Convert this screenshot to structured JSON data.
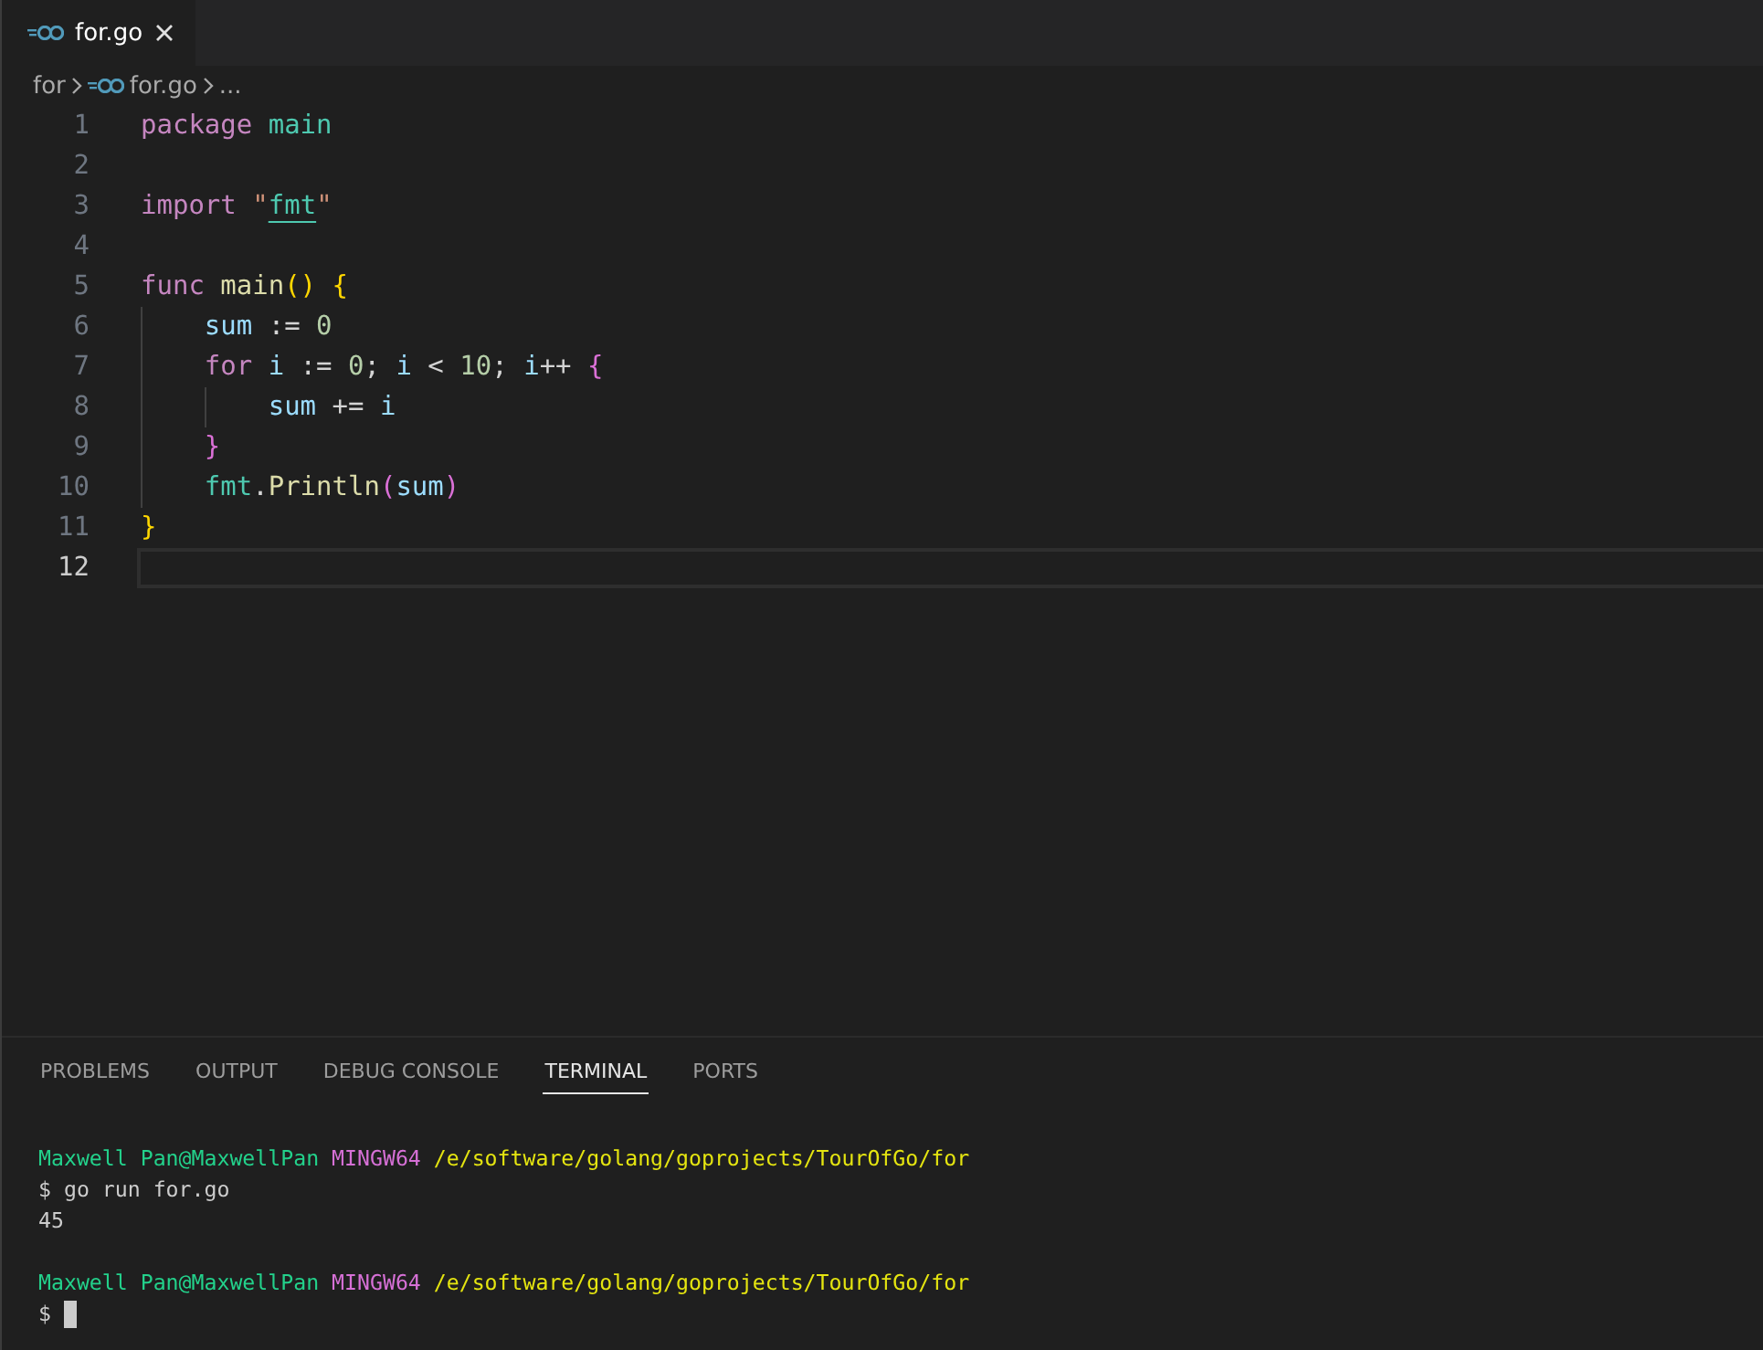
{
  "editor_tabs": [
    {
      "label": "for.go",
      "selected": true
    }
  ],
  "breadcrumb": [
    {
      "kind": "folder",
      "label": "for"
    },
    {
      "kind": "file",
      "label": "for.go"
    },
    {
      "kind": "more",
      "label": "..."
    }
  ],
  "code_lines": [
    {
      "number": "1",
      "current": false,
      "tokens": [
        {
          "kind": "keyword",
          "text": "package"
        },
        {
          "kind": "type",
          "text": " main"
        }
      ]
    },
    {
      "number": "2",
      "current": false
    },
    {
      "number": "3",
      "current": false,
      "tokens": [
        {
          "kind": "keyword",
          "text": "import"
        },
        {
          "kind": "string",
          "text": " \""
        },
        {
          "kind": "link",
          "text": "fmt"
        },
        {
          "kind": "string",
          "text": "\""
        }
      ]
    },
    {
      "number": "4",
      "current": false
    },
    {
      "number": "5",
      "current": false,
      "tokens": [
        {
          "kind": "keyword",
          "text": "func"
        },
        {
          "kind": "function",
          "text": " main"
        },
        {
          "kind": "bracket1",
          "text": "()"
        },
        {
          "kind": "bracket1",
          "text": " {"
        }
      ]
    },
    {
      "number": "6",
      "current": false,
      "tokens": [
        {
          "kind": "variable",
          "text": "    sum"
        },
        {
          "kind": "plain",
          "text": " := "
        },
        {
          "kind": "number",
          "text": "0"
        }
      ]
    },
    {
      "number": "7",
      "current": false,
      "tokens": [
        {
          "kind": "keyword",
          "text": "    for"
        },
        {
          "kind": "variable",
          "text": " i"
        },
        {
          "kind": "plain",
          "text": " := "
        },
        {
          "kind": "number",
          "text": "0"
        },
        {
          "kind": "plain",
          "text": "; "
        },
        {
          "kind": "variable",
          "text": "i"
        },
        {
          "kind": "plain",
          "text": " < "
        },
        {
          "kind": "number",
          "text": "10"
        },
        {
          "kind": "plain",
          "text": "; "
        },
        {
          "kind": "variable",
          "text": "i"
        },
        {
          "kind": "plain",
          "text": "++ "
        },
        {
          "kind": "bracket2",
          "text": "{"
        }
      ]
    },
    {
      "number": "8",
      "current": false,
      "tokens": [
        {
          "kind": "variable",
          "text": "        sum"
        },
        {
          "kind": "plain",
          "text": " += "
        },
        {
          "kind": "variable",
          "text": "i"
        }
      ]
    },
    {
      "number": "9",
      "current": false,
      "tokens": [
        {
          "kind": "bracket2",
          "text": "    }"
        }
      ]
    },
    {
      "number": "10",
      "current": false,
      "tokens": [
        {
          "kind": "type",
          "text": "    fmt"
        },
        {
          "kind": "plain",
          "text": "."
        },
        {
          "kind": "function",
          "text": "Println"
        },
        {
          "kind": "bracket2",
          "text": "("
        },
        {
          "kind": "variable",
          "text": "sum"
        },
        {
          "kind": "bracket2",
          "text": ")"
        }
      ]
    },
    {
      "number": "11",
      "current": false,
      "tokens": [
        {
          "kind": "bracket1",
          "text": "}"
        }
      ]
    },
    {
      "number": "12",
      "current": true
    }
  ],
  "panel_tabs": [
    {
      "label": "PROBLEMS",
      "selected": false
    },
    {
      "label": "OUTPUT",
      "selected": false
    },
    {
      "label": "DEBUG CONSOLE",
      "selected": false
    },
    {
      "label": "TERMINAL",
      "selected": true
    },
    {
      "label": "PORTS",
      "selected": false
    }
  ],
  "terminal_lines": [
    {
      "kind": "prompt",
      "segments": [
        {
          "kind": "user",
          "text": "Maxwell Pan@MaxwellPan"
        },
        {
          "kind": "system",
          "text": "MINGW64"
        },
        {
          "kind": "path",
          "text": "/e/software/golang/goprojects/TourOfGo/for"
        }
      ]
    },
    {
      "kind": "input",
      "text": "$ go run for.go",
      "cursor": false
    },
    {
      "kind": "output",
      "text": "45"
    },
    {
      "kind": "prompt",
      "segments": [
        {
          "kind": "user",
          "text": "Maxwell Pan@MaxwellPan"
        },
        {
          "kind": "system",
          "text": "MINGW64"
        },
        {
          "kind": "path",
          "text": "/e/software/golang/goprojects/TourOfGo/for"
        }
      ]
    },
    {
      "kind": "input",
      "text": "$",
      "cursor": true
    }
  ]
}
